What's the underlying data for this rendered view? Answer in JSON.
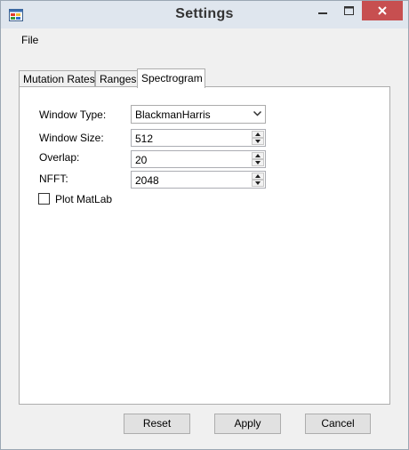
{
  "window": {
    "title": "Settings",
    "title_bar_color": "#dfe6ee",
    "close_color": "#c74f50"
  },
  "menu": {
    "file_label": "File"
  },
  "tabs": [
    {
      "label": "Mutation Rates"
    },
    {
      "label": "Ranges"
    },
    {
      "label": "Spectrogram"
    }
  ],
  "form": {
    "window_type": {
      "label": "Window Type:",
      "value": "BlackmanHarris"
    },
    "window_size": {
      "label": "Window Size:",
      "value": "512"
    },
    "overlap": {
      "label": "Overlap:",
      "value": "20"
    },
    "nfft": {
      "label": "NFFT:",
      "value": "2048"
    },
    "plot_matlab": {
      "label": "Plot MatLab",
      "checked": false
    }
  },
  "buttons": {
    "reset": "Reset",
    "apply": "Apply",
    "cancel": "Cancel"
  },
  "icons": {
    "app": "app-icon",
    "minimize": "minimize-icon",
    "maximize": "maximize-icon",
    "close": "close-icon",
    "dropdown": "chevron-down-icon",
    "spin_up": "arrow-up-icon",
    "spin_down": "arrow-down-icon"
  }
}
